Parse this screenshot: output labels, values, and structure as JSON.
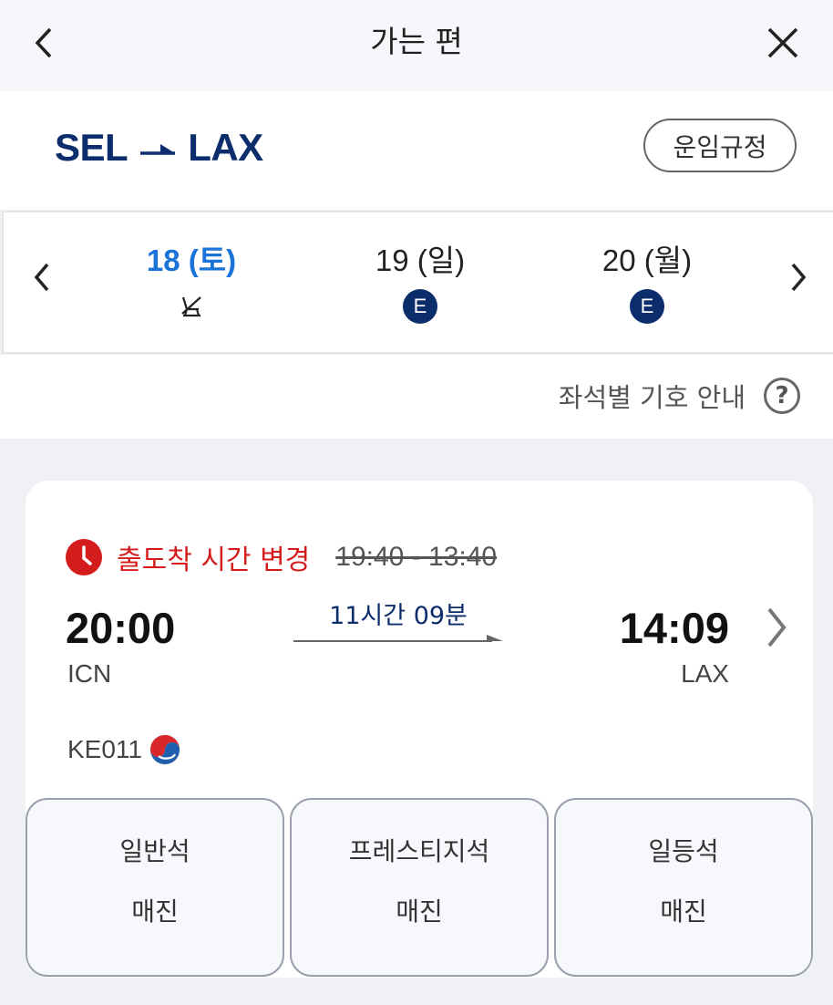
{
  "header": {
    "title": "가는 편"
  },
  "route": {
    "origin": "SEL",
    "destination": "LAX",
    "fare_rules_label": "운임규정"
  },
  "dates": [
    {
      "label": "18 (토)",
      "selected": true,
      "icon": "no-seat-icon"
    },
    {
      "label": "19 (일)",
      "selected": false,
      "badge": "E"
    },
    {
      "label": "20 (월)",
      "selected": false,
      "badge": "E"
    }
  ],
  "legend": {
    "label": "좌석별 기호 안내",
    "icon": "question-icon"
  },
  "flight": {
    "notice": "출도착 시간 변경",
    "old_schedule": "19:40 - 13:40",
    "departure_time": "20:00",
    "departure_code": "ICN",
    "arrival_time": "14:09",
    "arrival_code": "LAX",
    "duration": "11시간 09분",
    "flight_number": "KE011",
    "seats": [
      {
        "class": "일반석",
        "status": "매진"
      },
      {
        "class": "프레스티지석",
        "status": "매진"
      },
      {
        "class": "일등석",
        "status": "매진"
      }
    ]
  },
  "colors": {
    "brand_navy": "#0c2d6b",
    "selected_blue": "#1a73d9",
    "alert_red": "#d51c1c"
  }
}
